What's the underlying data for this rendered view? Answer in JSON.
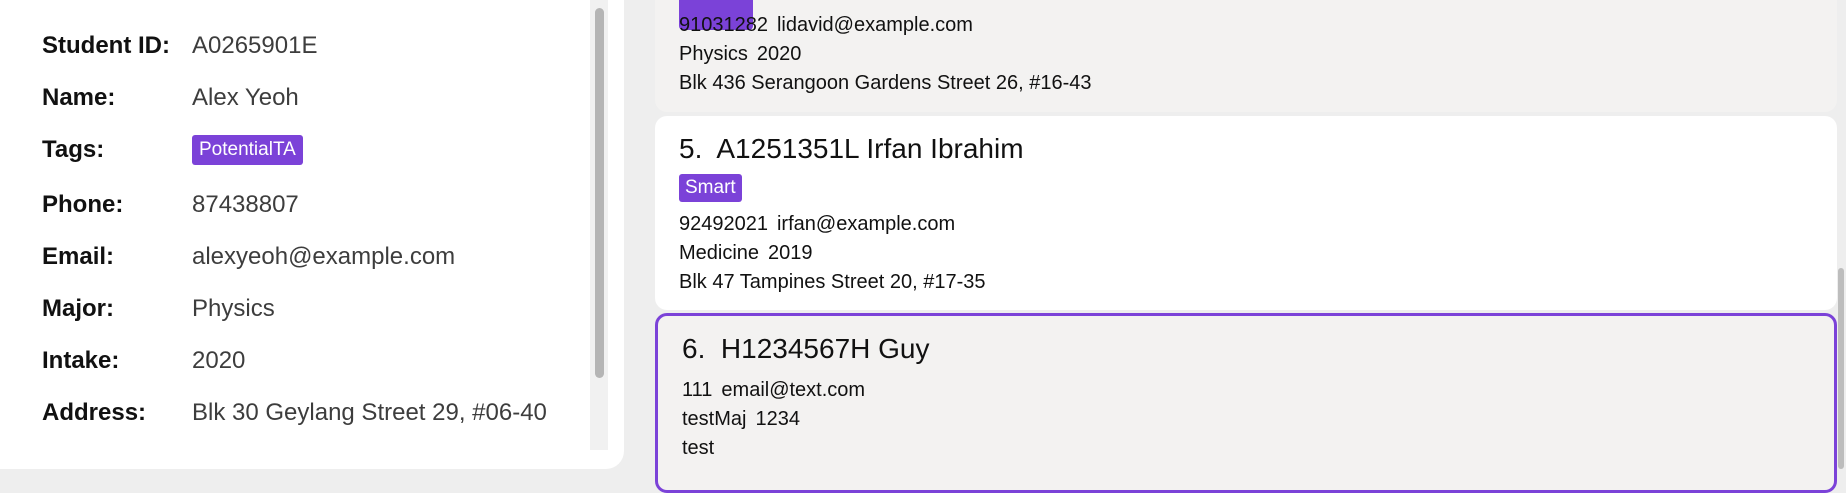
{
  "details": {
    "fields": [
      {
        "label": "Student ID:",
        "value": "A0265901E"
      },
      {
        "label": "Name:",
        "value": "Alex Yeoh"
      },
      {
        "label": "Tags:",
        "value": "PotentialTA"
      },
      {
        "label": "Phone:",
        "value": "87438807"
      },
      {
        "label": "Email:",
        "value": "alexyeoh@example.com"
      },
      {
        "label": "Major:",
        "value": "Physics"
      },
      {
        "label": "Intake:",
        "value": "2020"
      },
      {
        "label": "Address:",
        "value": "Blk 30 Geylang Street 29, #06-40"
      }
    ]
  },
  "list": {
    "prev_card": {
      "phone": "91031282",
      "email": "lidavid@example.com",
      "major": "Physics",
      "intake": "2020",
      "address": "Blk 436 Serangoon Gardens Street 26, #16-43"
    },
    "card5": {
      "index": "5.",
      "title": "A1251351L Irfan Ibrahim",
      "tag": "Smart",
      "phone": "92492021",
      "email": "irfan@example.com",
      "major": "Medicine",
      "intake": "2019",
      "address": "Blk 47 Tampines Street 20, #17-35"
    },
    "card6": {
      "index": "6.",
      "title": "H1234567H Guy",
      "phone": "111",
      "email": "email@text.com",
      "major": "testMaj",
      "intake": "1234",
      "address": "test"
    }
  },
  "colors": {
    "accent": "#7b42d8"
  }
}
